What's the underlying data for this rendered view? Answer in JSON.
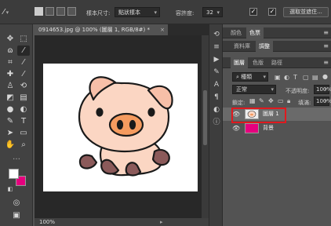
{
  "options_bar": {
    "sample_size_label": "樣本尺寸:",
    "sample_size_value": "點狀樣本",
    "tolerance_label": "容許度:",
    "tolerance_value": "32",
    "anti_alias_checked": true,
    "contiguous_checked": true,
    "select_subject_button": "選取並遮住..."
  },
  "document": {
    "tab_title": "0914653.jpg @ 100% (圖層 1, RGB/8#) *",
    "zoom": "100%"
  },
  "colors": {
    "foreground": "#ffffff",
    "background": "#e6007e",
    "highlight": "#e0191e"
  },
  "panels": {
    "color_tabs": [
      "顏色",
      "色票"
    ],
    "library_tabs": [
      "資料庫",
      "調整"
    ],
    "layer_tabs": [
      "圖層",
      "色版",
      "路徑"
    ],
    "filter_kind": "種類",
    "blend_mode": "正常",
    "opacity_label": "不透明度:",
    "opacity_value": "100%",
    "lock_label": "鎖定:",
    "fill_label": "填滿:",
    "fill_value": "100%"
  },
  "layers": [
    {
      "name": "圖層 1",
      "visible": true,
      "selected": true
    },
    {
      "name": "背景",
      "visible": true,
      "selected": false
    }
  ]
}
